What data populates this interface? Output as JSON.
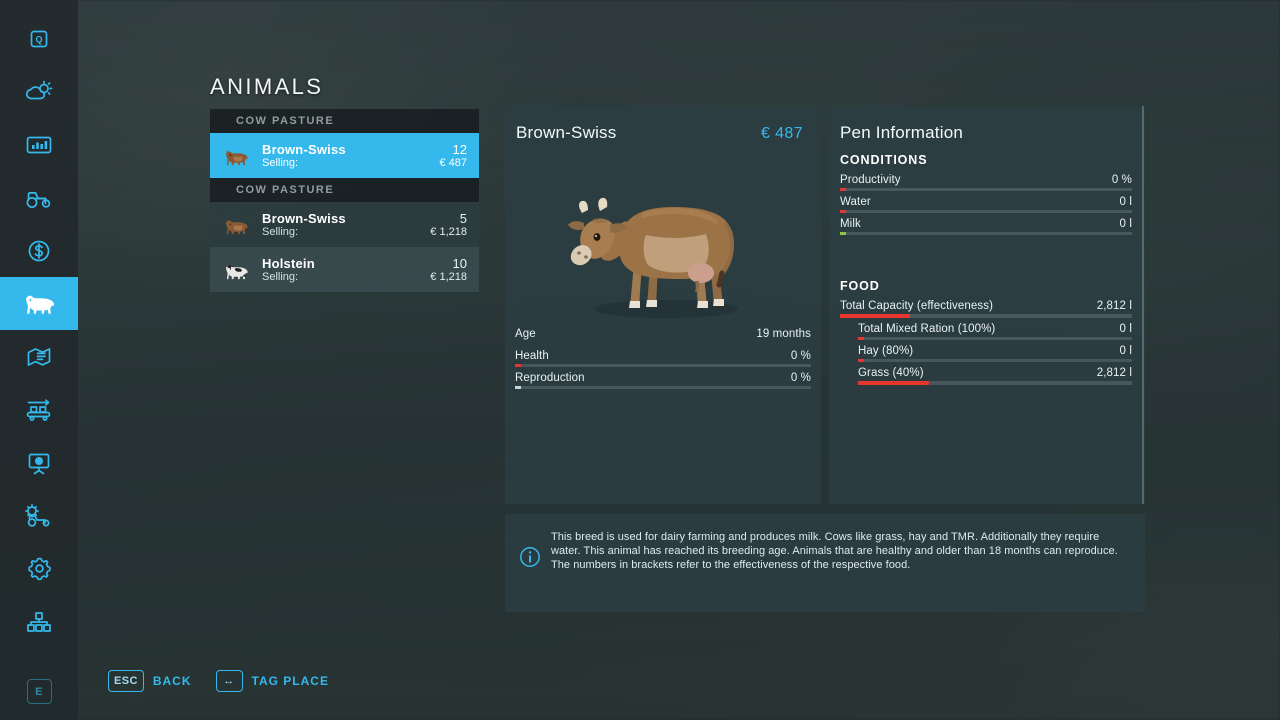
{
  "theme": {
    "accent": "#35b9ec",
    "panel_bg": "rgba(44,62,68,0.80)",
    "bar_red": "#e8352e",
    "bar_green": "#8cc63f",
    "bar_grey": "#c9d5d8",
    "text_primary": "#f3f8f9"
  },
  "page": {
    "title": "ANIMALS"
  },
  "sidebar": {
    "items": [
      {
        "name": "map-icon",
        "label": "Map",
        "active": false
      },
      {
        "name": "weather-icon",
        "label": "Weather",
        "active": false
      },
      {
        "name": "statistics-icon",
        "label": "Statistics",
        "active": false
      },
      {
        "name": "vehicles-icon",
        "label": "Vehicles",
        "active": false
      },
      {
        "name": "finances-icon",
        "label": "Finances",
        "active": false
      },
      {
        "name": "animals-icon",
        "label": "Animals",
        "active": true
      },
      {
        "name": "contracts-icon",
        "label": "Contracts",
        "active": false
      },
      {
        "name": "production-icon",
        "label": "Production",
        "active": false
      },
      {
        "name": "training-icon",
        "label": "Training",
        "active": false
      },
      {
        "name": "construction-icon",
        "label": "Construction",
        "active": false
      },
      {
        "name": "settings-icon",
        "label": "Settings",
        "active": false
      },
      {
        "name": "multiplayer-icon",
        "label": "Multiplayer",
        "active": false
      }
    ],
    "bottom_key": "E"
  },
  "animal_list": {
    "groups": [
      {
        "header": "COW PASTURE",
        "rows": [
          {
            "name": "Brown-Swiss",
            "count": "12",
            "sub_label": "Selling:",
            "price": "€ 487",
            "thumb": "brown-cow-thumb",
            "selected": true
          }
        ]
      },
      {
        "header": "COW PASTURE",
        "rows": [
          {
            "name": "Brown-Swiss",
            "count": "5",
            "sub_label": "Selling:",
            "price": "€ 1,218",
            "thumb": "brown-cow-thumb",
            "selected": false
          },
          {
            "name": "Holstein",
            "count": "10",
            "sub_label": "Selling:",
            "price": "€ 1,218",
            "thumb": "holstein-cow-thumb",
            "selected": false
          }
        ]
      }
    ]
  },
  "detail": {
    "title": "Brown-Swiss",
    "price": "€ 487",
    "preview": "brown-swiss-cow-render",
    "stats": [
      {
        "label": "Age",
        "value": "19 months",
        "fill_pct": 0,
        "color": "none",
        "has_bar": false
      },
      {
        "label": "Health",
        "value": "0 %",
        "fill_pct": 2,
        "color": "#e8352e",
        "has_bar": true
      },
      {
        "label": "Reproduction",
        "value": "0 %",
        "fill_pct": 2,
        "color": "#c9d5d8",
        "has_bar": true
      }
    ]
  },
  "pen": {
    "title": "Pen Information",
    "conditions_heading": "CONDITIONS",
    "conditions": [
      {
        "label": "Productivity",
        "value": "0 %",
        "fill_pct": 2,
        "color": "#e8352e"
      },
      {
        "label": "Water",
        "value": "0 l",
        "fill_pct": 2,
        "color": "#e8352e"
      },
      {
        "label": "Milk",
        "value": "0 l",
        "fill_pct": 2,
        "color": "#8cc63f"
      }
    ],
    "food_heading": "FOOD",
    "food": [
      {
        "label": "Total Capacity (effectiveness)",
        "value": "2,812 l",
        "fill_pct": 24,
        "color": "#e8352e",
        "indent": false
      },
      {
        "label": "Total Mixed Ration (100%)",
        "value": "0 l",
        "fill_pct": 2,
        "color": "#e8352e",
        "indent": true
      },
      {
        "label": "Hay (80%)",
        "value": "0 l",
        "fill_pct": 2,
        "color": "#e8352e",
        "indent": true
      },
      {
        "label": "Grass (40%)",
        "value": "2,812 l",
        "fill_pct": 26,
        "color": "#e8352e",
        "indent": true
      }
    ]
  },
  "info": {
    "icon": "info-icon",
    "text": "This breed is used for dairy farming and produces milk. Cows like grass, hay and TMR. Additionally they require water. This animal has reached its breeding age. Animals that are healthy and older than 18 months can reproduce. The numbers in brackets refer to the effectiveness of the respective food."
  },
  "help_bar": {
    "items": [
      {
        "key": "ESC",
        "key_icon": "esc-key",
        "label": "BACK"
      },
      {
        "key": "↔",
        "key_icon": "left-right-arrow-key",
        "label": "TAG PLACE"
      }
    ]
  }
}
